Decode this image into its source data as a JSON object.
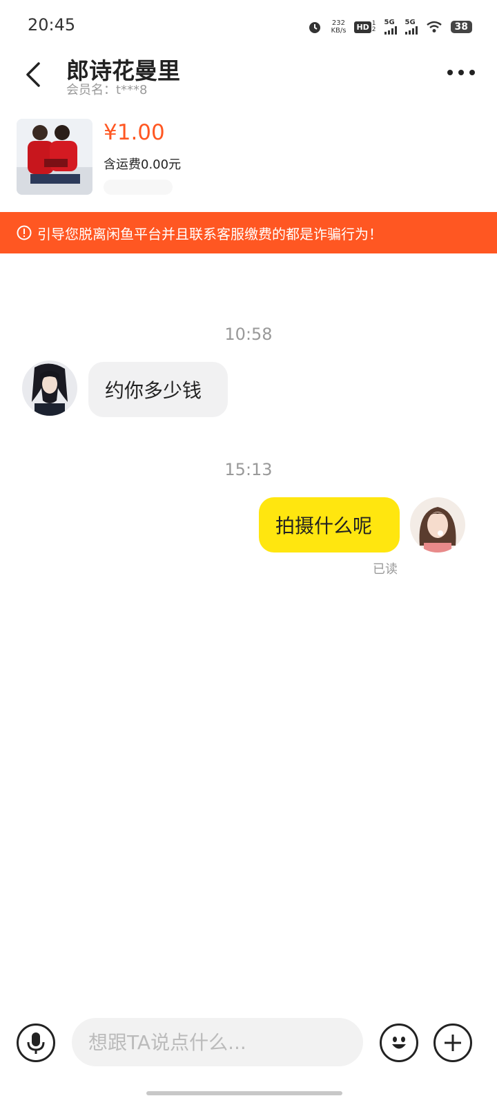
{
  "status_bar": {
    "time": "20:45",
    "net_speed_value": "232",
    "net_speed_unit": "KB/s",
    "hd": "HD",
    "hd_sub_top": "1",
    "hd_sub_bottom": "2",
    "signal1": "5G",
    "signal2": "5G",
    "battery": "38"
  },
  "header": {
    "title": "郎诗花曼里",
    "member_label": "会员名：",
    "member_value": "t***8"
  },
  "product": {
    "price": "¥1.00",
    "shipping": "含运费0.00元"
  },
  "warning": {
    "text": "引导您脱离闲鱼平台并且联系客服缴费的都是诈骗行为！"
  },
  "messages": [
    {
      "time": "10:58",
      "direction": "incoming",
      "text": "约你多少钱"
    },
    {
      "time": "15:13",
      "direction": "outgoing",
      "text": "拍摄什么呢",
      "status": "已读"
    }
  ],
  "input": {
    "placeholder": "想跟TA说点什么..."
  },
  "colors": {
    "accent_orange": "#ff5722",
    "bubble_yellow": "#ffe60f",
    "bubble_gray": "#f1f1f2"
  },
  "icons": {
    "back": "chevron-left-icon",
    "more": "more-dots-icon",
    "voice": "microphone-icon",
    "emoji": "emoji-icon",
    "plus": "plus-icon",
    "warning": "alert-circle-icon"
  }
}
